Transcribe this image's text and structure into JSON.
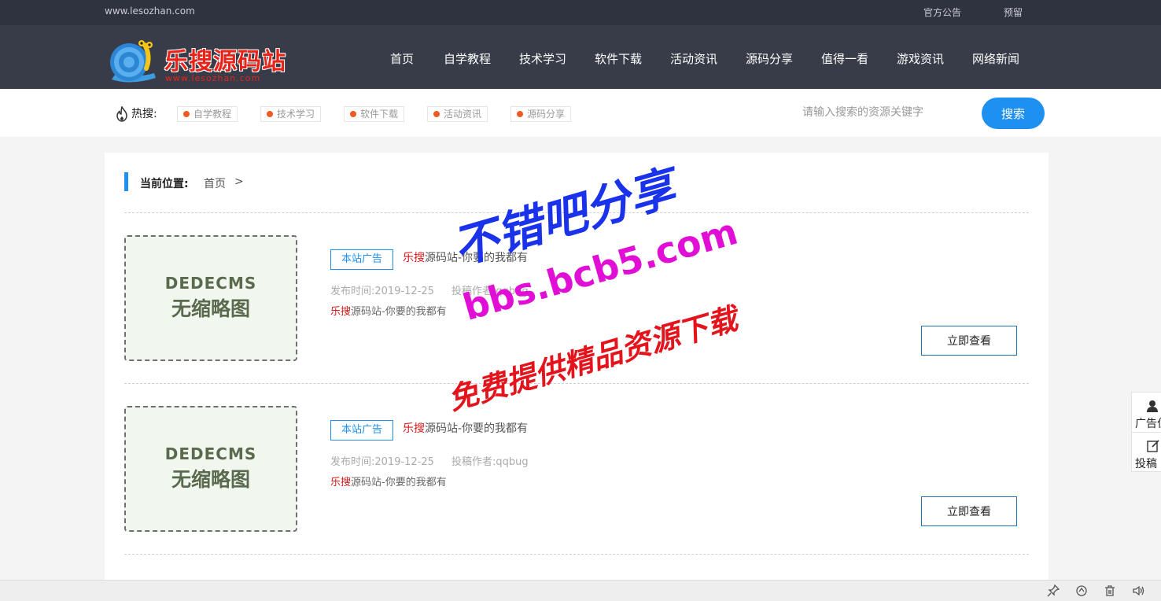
{
  "topbar": {
    "domain": "www.lesozhan.com",
    "links": [
      "官方公告",
      "预留"
    ]
  },
  "header": {
    "logo_name": "乐搜源码站",
    "logo_url": "www.lesozhan.com",
    "nav": [
      "首页",
      "自学教程",
      "技术学习",
      "软件下载",
      "活动资讯",
      "源码分享",
      "值得一看",
      "游戏资讯",
      "网络新闻"
    ]
  },
  "search": {
    "hot_label": "热搜:",
    "hot_tags": [
      "自学教程",
      "技术学习",
      "软件下载",
      "活动资讯",
      "源码分享"
    ],
    "placeholder": "请输入搜索的资源关键字",
    "button": "搜索"
  },
  "breadcrumb": {
    "label": "当前位置:",
    "home": "首页",
    "sep": ">"
  },
  "articles": [
    {
      "thumb_line1": "DEDECMS",
      "thumb_line2": "无缩略图",
      "badge": "本站广告",
      "title_hl": "乐搜",
      "title_rest": "源码站-你要的我都有",
      "date": "发布时间:2019-12-25",
      "author": "投稿作者:qqbug",
      "desc_hl": "乐搜",
      "desc_rest": "源码站-你要的我都有",
      "button": "立即查看"
    },
    {
      "thumb_line1": "DEDECMS",
      "thumb_line2": "无缩略图",
      "badge": "本站广告",
      "title_hl": "乐搜",
      "title_rest": "源码站-你要的我都有",
      "date": "发布时间:2019-12-25",
      "author": "投稿作者:qqbug",
      "desc_hl": "乐搜",
      "desc_rest": "源码站-你要的我都有",
      "button": "立即查看"
    }
  ],
  "watermark": {
    "line1": "不错吧分享",
    "line2": "bbs.bcb5.com",
    "line3": "免费提供精品资源下载"
  },
  "side_widget": {
    "items": [
      "广告位",
      "投稿"
    ]
  },
  "colors": {
    "topbar_bg": "#2f3340",
    "header_bg": "#383c48",
    "accent": "#1e90f2",
    "brand_red": "#e8231a",
    "hot_dot": "#f05a22"
  },
  "statusbar_icons": [
    "pin-icon",
    "refresh-icon",
    "trash-icon",
    "speaker-icon"
  ]
}
